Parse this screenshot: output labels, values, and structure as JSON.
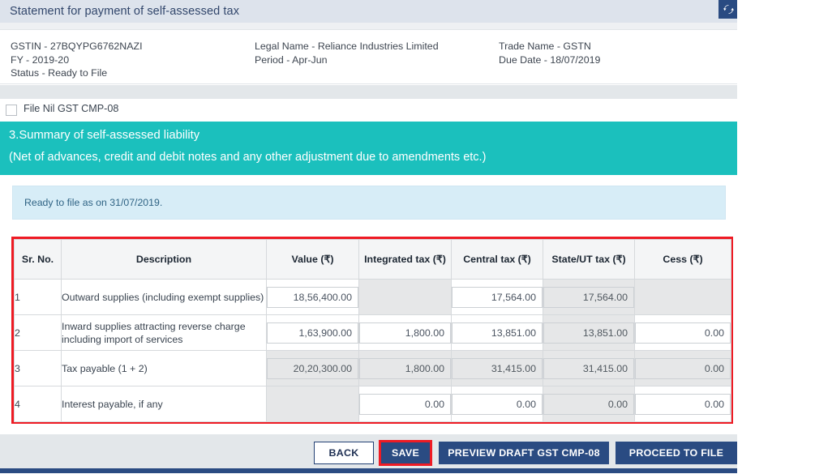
{
  "header": {
    "title": "Statement for payment of self-assessed tax",
    "refresh_icon": "refresh-icon"
  },
  "taxpayer_info": {
    "col1": [
      "GSTIN - 27BQYPG6762NAZI",
      "FY - 2019-20",
      "Status - Ready to File"
    ],
    "col2": [
      "Legal Name - Reliance Industries Limited",
      "Period - Apr-Jun"
    ],
    "col3": [
      "Trade Name - GSTN",
      "Due Date - 18/07/2019"
    ]
  },
  "nil_filing": {
    "label": "File Nil GST CMP-08",
    "checked": false
  },
  "section": {
    "heading": "3.Summary of self-assessed liability",
    "subheading": "(Net of advances, credit and debit notes and any other adjustment due to amendments etc.)",
    "accent_color": "#1bc0bd"
  },
  "notice": {
    "text": "Ready to file as on 31/07/2019.",
    "background": "#d7edf7"
  },
  "table": {
    "highlight_color": "#ee1b24",
    "columns": [
      "Sr. No.",
      "Description",
      "Value (₹)",
      "Integrated tax (₹)",
      "Central tax (₹)",
      "State/UT tax (₹)",
      "Cess (₹)"
    ],
    "rows": [
      {
        "sr": "1",
        "description": "Outward supplies (including exempt supplies)",
        "value": {
          "text": "18,56,400.00",
          "state": "editable"
        },
        "integrated_tax": {
          "text": "",
          "state": "disabled-blank"
        },
        "central_tax": {
          "text": "17,564.00",
          "state": "editable"
        },
        "state_ut_tax": {
          "text": "17,564.00",
          "state": "readonly"
        },
        "cess": {
          "text": "",
          "state": "disabled-blank"
        }
      },
      {
        "sr": "2",
        "description": "Inward supplies attracting reverse charge including import of services",
        "value": {
          "text": "1,63,900.00",
          "state": "editable"
        },
        "integrated_tax": {
          "text": "1,800.00",
          "state": "editable"
        },
        "central_tax": {
          "text": "13,851.00",
          "state": "editable"
        },
        "state_ut_tax": {
          "text": "13,851.00",
          "state": "readonly"
        },
        "cess": {
          "text": "0.00",
          "state": "editable"
        }
      },
      {
        "sr": "3",
        "description": "Tax payable (1 + 2)",
        "value": {
          "text": "20,20,300.00",
          "state": "readonly"
        },
        "integrated_tax": {
          "text": "1,800.00",
          "state": "readonly"
        },
        "central_tax": {
          "text": "31,415.00",
          "state": "readonly"
        },
        "state_ut_tax": {
          "text": "31,415.00",
          "state": "readonly"
        },
        "cess": {
          "text": "0.00",
          "state": "readonly"
        }
      },
      {
        "sr": "4",
        "description": "Interest payable, if any",
        "value": {
          "text": "",
          "state": "disabled-blank"
        },
        "integrated_tax": {
          "text": "0.00",
          "state": "editable"
        },
        "central_tax": {
          "text": "0.00",
          "state": "editable"
        },
        "state_ut_tax": {
          "text": "0.00",
          "state": "readonly"
        },
        "cess": {
          "text": "0.00",
          "state": "editable"
        }
      }
    ]
  },
  "footer": {
    "back": "BACK",
    "save": "SAVE",
    "preview": "PREVIEW DRAFT GST CMP-08",
    "proceed": "PROCEED TO FILE",
    "save_highlight_color": "#ee1b24",
    "primary_color": "#2a4b82"
  }
}
